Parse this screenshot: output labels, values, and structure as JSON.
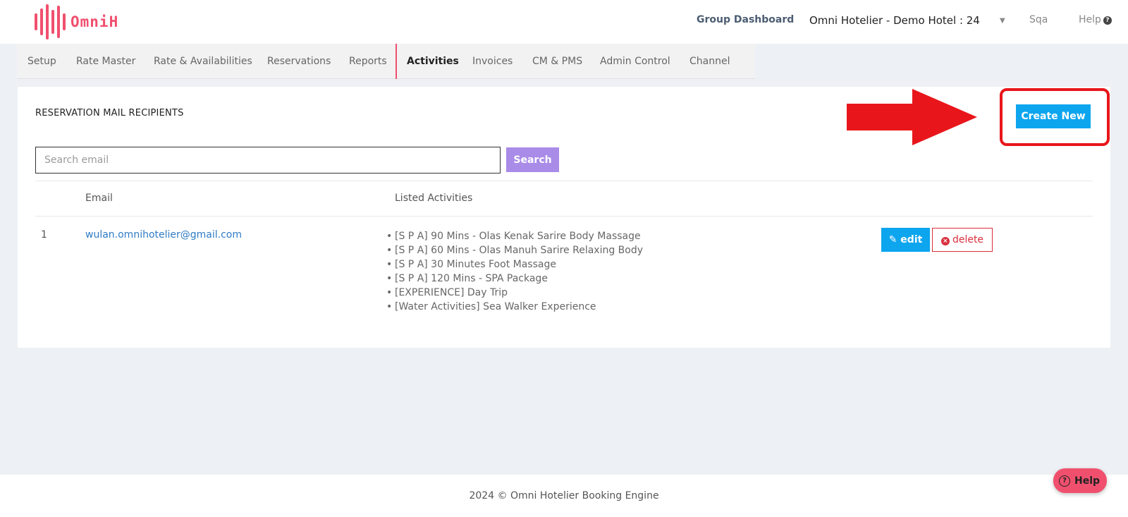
{
  "brand": {
    "name": "OmniH",
    "accent": "#f0506e"
  },
  "header": {
    "group_dashboard": "Group Dashboard",
    "hotel_selector": "Omni Hotelier - Demo Hotel : 24",
    "user": "Sqa",
    "help": "Help"
  },
  "nav": {
    "items": [
      {
        "label": "Setup"
      },
      {
        "label": "Rate Master"
      },
      {
        "label": "Rate & Availabilities"
      },
      {
        "label": "Reservations"
      },
      {
        "label": "Reports"
      },
      {
        "label": "Activities",
        "active": true
      },
      {
        "label": "Invoices"
      },
      {
        "label": "CM & PMS"
      },
      {
        "label": "Admin Control"
      },
      {
        "label": "Channel"
      }
    ]
  },
  "page": {
    "title": "RESERVATION MAIL RECIPIENTS",
    "create_button": "Create New",
    "search": {
      "placeholder": "Search email",
      "value": "",
      "button": "Search"
    }
  },
  "table": {
    "columns": [
      "",
      "Email",
      "Listed Activities",
      ""
    ],
    "rows": [
      {
        "num": "1",
        "email": "wulan.omnihotelier@gmail.com",
        "activities": [
          "[S P A] 90 Mins - Olas Kenak Sarire Body Massage",
          "[S P A] 60 Mins - Olas Manuh Sarire Relaxing Body",
          "[S P A] 30 Minutes Foot Massage",
          "[S P A] 120 Mins - SPA Package",
          "[EXPERIENCE] Day Trip",
          "[Water Activities] Sea Walker Experience"
        ],
        "edit": "edit",
        "delete": "delete"
      }
    ]
  },
  "footer": {
    "text": "2024 © Omni Hotelier Booking Engine"
  },
  "help_widget": {
    "label": "Help"
  },
  "annotation": {
    "color": "#e8161b"
  }
}
